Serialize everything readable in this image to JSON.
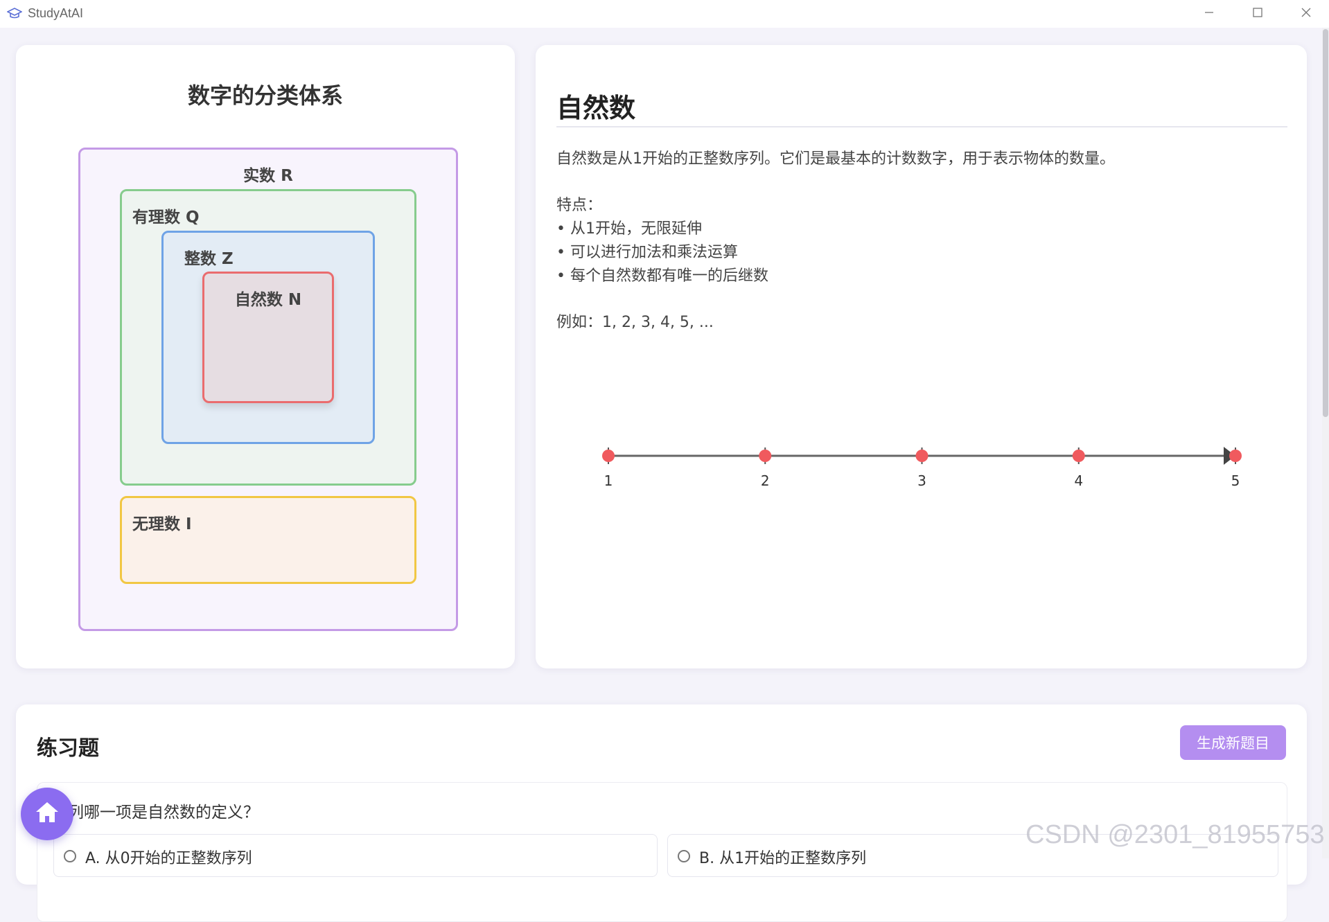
{
  "window": {
    "app_name": "StudyAtAI",
    "icons": {
      "logo": "graduation-cap-icon",
      "minimize": "minimize-icon",
      "maximize": "maximize-icon",
      "close": "close-icon"
    }
  },
  "diagram": {
    "title": "数字的分类体系",
    "sets": {
      "real": "实数 R",
      "rational": "有理数 Q",
      "integer": "整数 Z",
      "natural": "自然数 N",
      "irrational": "无理数 I"
    },
    "colors": {
      "real": "#c49ae6",
      "rational": "#86cc8d",
      "integer": "#6fa3e6",
      "natural": "#ea6c6e",
      "irrational": "#f1c744"
    }
  },
  "info": {
    "title": "自然数",
    "description": "自然数是从1开始的正整数序列。它们是最基本的计数数字，用于表示物体的数量。",
    "features_heading": "特点：",
    "features": [
      "• 从1开始，无限延伸",
      "• 可以进行加法和乘法运算",
      "• 每个自然数都有唯一的后继数"
    ],
    "example": "例如：1, 2, 3, 4, 5, ..."
  },
  "number_line": {
    "points": [
      "1",
      "2",
      "3",
      "4",
      "5"
    ],
    "point_color": "#f05a5e"
  },
  "exercise": {
    "title": "练习题",
    "generate_button": "生成新题目",
    "question": "下列哪一项是自然数的定义？",
    "options": [
      "A. 从0开始的正整数序列",
      "B. 从1开始的正整数序列"
    ]
  },
  "home_button": {
    "icon": "home-icon"
  },
  "watermark": "CSDN @2301_81955753"
}
